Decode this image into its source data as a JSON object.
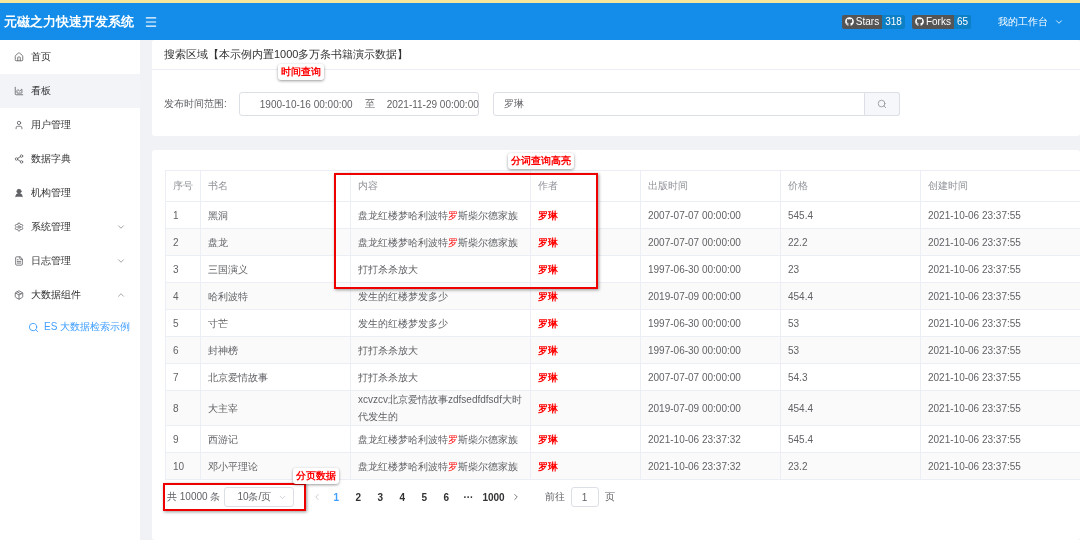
{
  "header": {
    "title": "元磁之力快速开发系统",
    "badges": [
      {
        "label": "Stars",
        "count": "318"
      },
      {
        "label": "Forks",
        "count": "65"
      }
    ],
    "user_menu": "我的工作台"
  },
  "sidebar": {
    "items": [
      {
        "label": "首页",
        "selected": false
      },
      {
        "label": "看板",
        "selected": true
      },
      {
        "label": "用户管理",
        "selected": false
      },
      {
        "label": "数据字典",
        "selected": false
      },
      {
        "label": "机构管理",
        "selected": false
      },
      {
        "label": "系统管理",
        "selected": false,
        "expanded": false
      },
      {
        "label": "日志管理",
        "selected": false,
        "expanded": false
      },
      {
        "label": "大数据组件",
        "selected": false,
        "expanded": true,
        "children": [
          {
            "label": "ES 大数据检索示例",
            "selected": true
          }
        ]
      }
    ]
  },
  "search": {
    "title": "搜索区域【本示例内置1000多万条书籍演示数据】",
    "date_label": "发布时间范围:",
    "date_start": "1900-10-16 00:00:00",
    "date_separator": "至",
    "date_end": "2021-11-29 00:00:00",
    "keyword": "罗琳"
  },
  "table": {
    "columns": [
      "序号",
      "书名",
      "内容",
      "作者",
      "出版时间",
      "价格",
      "创建时间"
    ],
    "rows": [
      [
        "1",
        "黑洞",
        "盘龙红楼梦哈利波特**罗**斯柴尔德家族",
        "罗琳",
        "2007-07-07 00:00:00",
        "545.4",
        "2021-10-06 23:37:55"
      ],
      [
        "2",
        "盘龙",
        "盘龙红楼梦哈利波特**罗**斯柴尔德家族",
        "罗琳",
        "2007-07-07 00:00:00",
        "22.2",
        "2021-10-06 23:37:55"
      ],
      [
        "3",
        "三国演义",
        "打打杀杀放大",
        "罗琳",
        "1997-06-30 00:00:00",
        "23",
        "2021-10-06 23:37:55"
      ],
      [
        "4",
        "哈利波特",
        "发生的红楼梦发多少",
        "罗琳",
        "2019-07-09 00:00:00",
        "454.4",
        "2021-10-06 23:37:55"
      ],
      [
        "5",
        "寸芒",
        "发生的红楼梦发多少",
        "罗琳",
        "1997-06-30 00:00:00",
        "53",
        "2021-10-06 23:37:55"
      ],
      [
        "6",
        "封神榜",
        "打打杀杀放大",
        "罗琳",
        "1997-06-30 00:00:00",
        "53",
        "2021-10-06 23:37:55"
      ],
      [
        "7",
        "北京爱情故事",
        "打打杀杀放大",
        "罗琳",
        "2007-07-07 00:00:00",
        "54.3",
        "2021-10-06 23:37:55"
      ],
      [
        "8",
        "大主宰",
        "xcvzcv北京爱情故事zdfsedfdfsdf大时代发生的",
        "罗琳",
        "2019-07-09 00:00:00",
        "454.4",
        "2021-10-06 23:37:55"
      ],
      [
        "9",
        "西游记",
        "盘龙红楼梦哈利波特**罗**斯柴尔德家族",
        "罗琳",
        "2021-10-06 23:37:32",
        "545.4",
        "2021-10-06 23:37:55"
      ],
      [
        "10",
        "邓小平理论",
        "盘龙红楼梦哈利波特**罗**斯柴尔德家族",
        "罗琳",
        "2021-10-06 23:37:32",
        "23.2",
        "2021-10-06 23:37:55"
      ]
    ]
  },
  "pagination": {
    "total": "共 10000 条",
    "page_size": "10条/页",
    "pages": [
      {
        "label": "1",
        "selected": true
      },
      {
        "label": "2",
        "selected": false
      },
      {
        "label": "3",
        "selected": false
      },
      {
        "label": "4",
        "selected": false
      },
      {
        "label": "5",
        "selected": false
      },
      {
        "label": "6",
        "selected": false
      },
      {
        "label": "···",
        "selected": false
      },
      {
        "label": "1000",
        "selected": false
      }
    ],
    "goto_label": "前往",
    "goto_value": "1",
    "goto_suffix": "页"
  },
  "annotations": [
    {
      "kind": "label",
      "text": "时间查询"
    },
    {
      "kind": "label",
      "text": "分词查询高亮"
    },
    {
      "kind": "label",
      "text": "分页数据"
    }
  ]
}
